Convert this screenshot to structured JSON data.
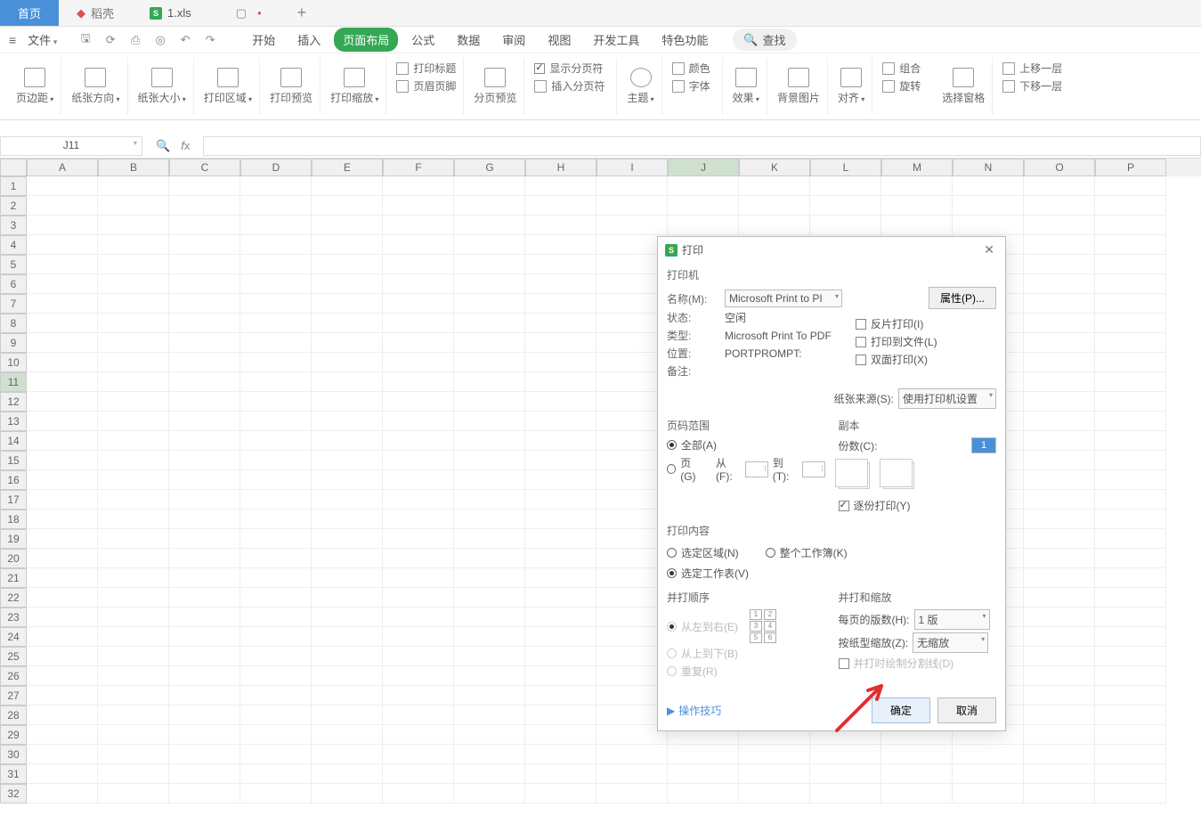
{
  "tabs": {
    "home": "首页",
    "app": "稻壳",
    "file": "1.xls"
  },
  "menubar": {
    "file": "文件"
  },
  "menu_tabs": {
    "start": "开始",
    "insert": "插入",
    "page_layout": "页面布局",
    "formula": "公式",
    "data": "数据",
    "review": "审阅",
    "view": "视图",
    "dev": "开发工具",
    "special": "特色功能",
    "search": "查找"
  },
  "ribbon": {
    "margin": "页边距",
    "orientation": "纸张方向",
    "size": "纸张大小",
    "print_area": "打印区域",
    "print_preview": "打印预览",
    "print_scale": "打印缩放",
    "print_title": "打印标题",
    "header_footer": "页眉页脚",
    "page_break": "分页预览",
    "show_break": "显示分页符",
    "insert_break": "插入分页符",
    "theme": "主题",
    "color": "颜色",
    "font": "字体",
    "effect": "效果",
    "bg_image": "背景图片",
    "align": "对齐",
    "group": "组合",
    "rotate": "旋转",
    "select_pane": "选择窗格",
    "move_up": "上移一层",
    "move_down": "下移一层"
  },
  "cell_ref": "J11",
  "columns": [
    "A",
    "B",
    "C",
    "D",
    "E",
    "F",
    "G",
    "H",
    "I",
    "J",
    "K",
    "L",
    "M",
    "N",
    "O",
    "P"
  ],
  "rows": [
    "1",
    "2",
    "3",
    "4",
    "5",
    "6",
    "7",
    "8",
    "9",
    "10",
    "11",
    "12",
    "13",
    "14",
    "15",
    "16",
    "17",
    "18",
    "19",
    "20",
    "21",
    "22",
    "23",
    "24",
    "25",
    "26",
    "27",
    "28",
    "29",
    "30",
    "31",
    "32"
  ],
  "active_col": "J",
  "active_row": "11",
  "dialog": {
    "title": "打印",
    "printer_section": "打印机",
    "name_label": "名称(M):",
    "name_value": "Microsoft Print to PI",
    "properties_btn": "属性(P)...",
    "status_label": "状态:",
    "status_value": "空闲",
    "type_label": "类型:",
    "type_value": "Microsoft Print To PDF",
    "location_label": "位置:",
    "location_value": "PORTPROMPT:",
    "comment_label": "备注:",
    "reverse_print": "反片打印(I)",
    "print_to_file": "打印到文件(L)",
    "duplex": "双面打印(X)",
    "paper_source_label": "纸张来源(S):",
    "paper_source_value": "使用打印机设置",
    "page_range_section": "页码范围",
    "all_pages": "全部(A)",
    "page_radio": "页(G)",
    "from_label": "从(F):",
    "to_label": "到(T):",
    "copies_section": "副本",
    "copies_label": "份数(C):",
    "copies_value": "1",
    "collate": "逐份打印(Y)",
    "print_content_section": "打印内容",
    "selection": "选定区域(N)",
    "workbook": "整个工作簿(K)",
    "sheets": "选定工作表(V)",
    "print_order_section": "并打顺序",
    "ltr": "从左到右(E)",
    "ttb": "从上到下(B)",
    "repeat": "重复(R)",
    "print_scale_section": "并打和缩放",
    "pages_per_sheet_label": "每页的版数(H):",
    "pages_per_sheet_value": "1 版",
    "scale_to_paper_label": "按纸型缩放(Z):",
    "scale_to_paper_value": "无缩放",
    "draw_lines": "并打时绘制分割线(D)",
    "tips": "操作技巧",
    "ok": "确定",
    "cancel": "取消"
  }
}
